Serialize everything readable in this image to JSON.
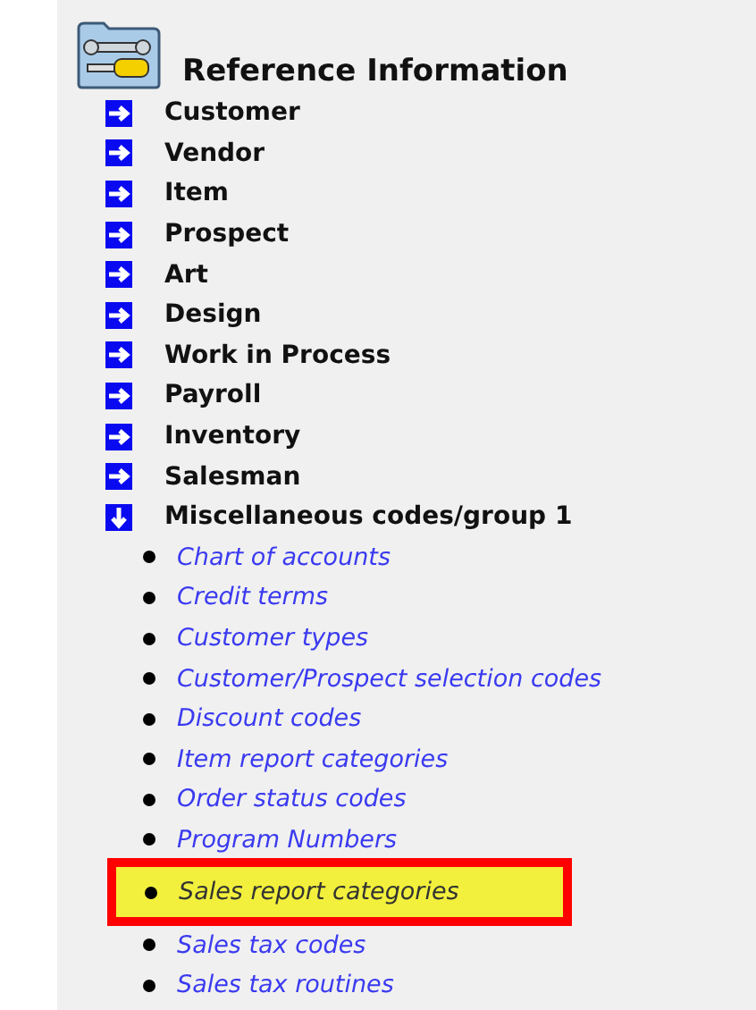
{
  "title": "Reference Information",
  "items": [
    {
      "label": "Customer",
      "expanded": false
    },
    {
      "label": "Vendor",
      "expanded": false
    },
    {
      "label": "Item",
      "expanded": false
    },
    {
      "label": "Prospect",
      "expanded": false
    },
    {
      "label": "Art",
      "expanded": false
    },
    {
      "label": "Design",
      "expanded": false
    },
    {
      "label": "Work in Process",
      "expanded": false
    },
    {
      "label": "Payroll",
      "expanded": false
    },
    {
      "label": "Inventory",
      "expanded": false
    },
    {
      "label": "Salesman",
      "expanded": false
    },
    {
      "label": "Miscellaneous codes/group 1",
      "expanded": true,
      "children": [
        {
          "label": "Chart of accounts",
          "highlighted": false
        },
        {
          "label": "Credit terms",
          "highlighted": false
        },
        {
          "label": "Customer types",
          "highlighted": false
        },
        {
          "label": "Customer/Prospect selection codes",
          "highlighted": false
        },
        {
          "label": "Discount codes",
          "highlighted": false
        },
        {
          "label": "Item report categories",
          "highlighted": false
        },
        {
          "label": "Order status codes",
          "highlighted": false
        },
        {
          "label": "Program Numbers",
          "highlighted": false
        },
        {
          "label": "Sales report categories",
          "highlighted": true
        },
        {
          "label": "Sales tax codes",
          "highlighted": false
        },
        {
          "label": "Sales tax routines",
          "highlighted": false
        }
      ]
    }
  ]
}
